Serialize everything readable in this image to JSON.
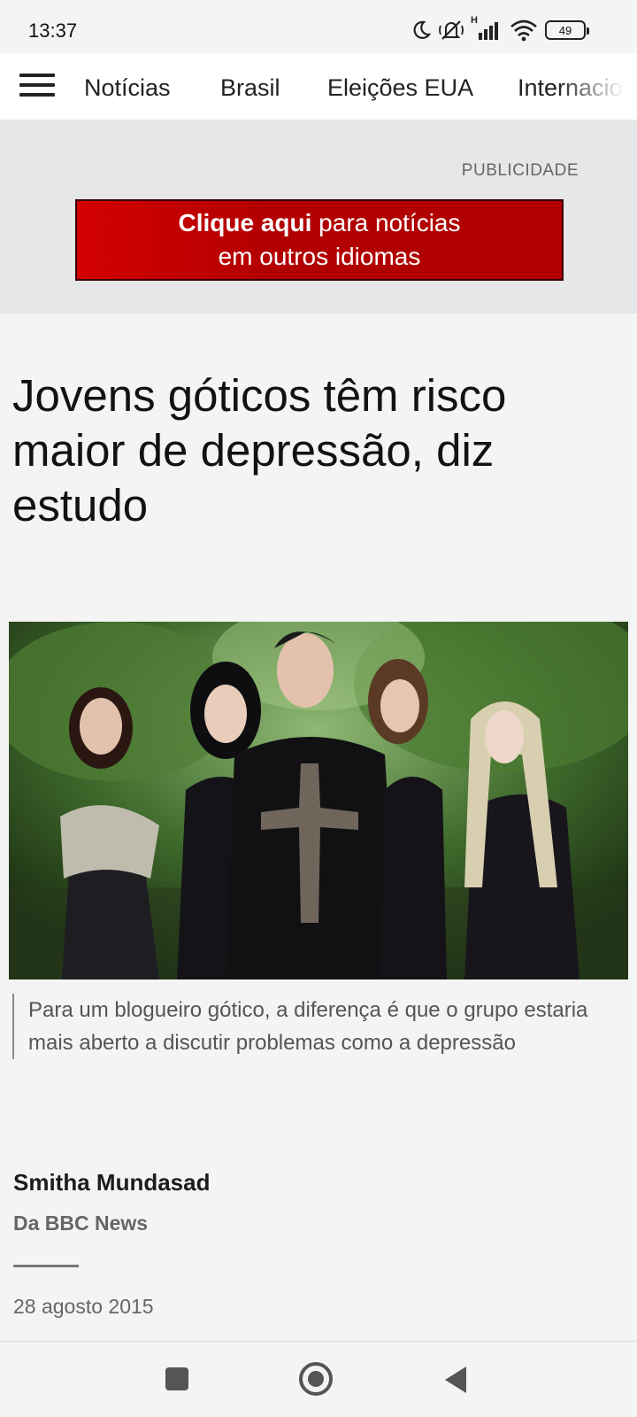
{
  "status_bar": {
    "time": "13:37",
    "network_label": "H",
    "battery": "49",
    "icons": [
      "moon-icon",
      "mute-icon",
      "signal-icon",
      "wifi-icon",
      "battery-icon"
    ]
  },
  "nav": {
    "menu_icon": "hamburger-menu-icon",
    "items": [
      "Notícias",
      "Brasil",
      "Eleições EUA",
      "Internacio"
    ]
  },
  "ad": {
    "label": "PUBLICIDADE",
    "banner_bold": "Clique aqui",
    "banner_rest_line1": " para notícias",
    "banner_line2": "em outros idiomas",
    "colors": {
      "banner_bg": "#c00000"
    }
  },
  "article": {
    "headline": "Jovens góticos têm risco maior de depressão, diz estudo",
    "image_caption": "Para um blogueiro gótico, a diferença é que o grupo estaria mais aberto a discutir problemas como a depressão",
    "author": "Smitha Mundasad",
    "source": "Da BBC News",
    "date": "28 agosto 2015"
  },
  "system_nav": {
    "icons": [
      "recents-square-icon",
      "home-circle-icon",
      "back-triangle-icon"
    ]
  }
}
